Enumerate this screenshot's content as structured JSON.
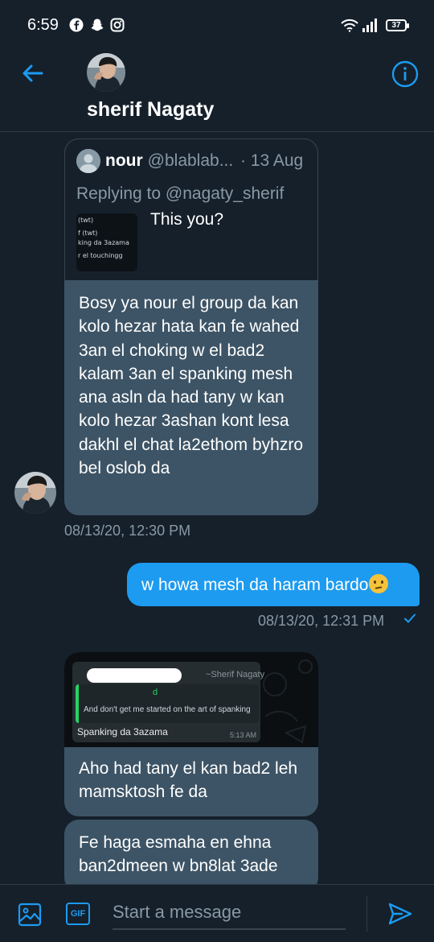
{
  "status_bar": {
    "time": "6:59",
    "icons": [
      "facebook-icon",
      "snapchat-icon",
      "instagram-icon",
      "wifi-icon",
      "signal-icon"
    ],
    "battery": "37"
  },
  "header": {
    "name": "sherif Nagaty",
    "back_icon": "back-arrow-icon",
    "info_icon": "info-icon"
  },
  "quoted_tweet": {
    "author": "nour",
    "handle": "@blablab...",
    "date": "· 13 Aug",
    "replying_prefix": "Replying to ",
    "replying_handle": "@nagaty_sherif",
    "text": "This you?",
    "thumb_lines": [
      "(twt)",
      "f (twt)",
      "king da 3azama",
      "r el touchingg"
    ]
  },
  "messages": [
    {
      "text": "Bosy ya nour el group da kan kolo hezar hata kan fe wahed 3an el choking w el bad2 kalam 3an el spanking mesh ana asln da had tany w kan kolo hezar 3ashan kont lesa dakhl el chat la2ethom byhzro bel oslob da",
      "timestamp": "08/13/20, 12:30 PM"
    },
    {
      "text": "w howa mesh da haram bardo",
      "timestamp": "08/13/20, 12:31 PM"
    },
    {
      "whatsapp_name": "~Sherif Nagaty",
      "whatsapp_quote_mark": "d",
      "whatsapp_quote": "And don't get me started on the art of spanking",
      "whatsapp_message": "Spanking da 3azama",
      "whatsapp_time": "5:13 AM",
      "text": "Aho had tany el kan bad2 leh mamsktosh fe da"
    },
    {
      "text": "Fe haga esmaha en ehna ban2dmeen w bn8lat 3ade"
    }
  ],
  "composer": {
    "placeholder": "Start a message",
    "gif_label": "GIF"
  },
  "colors": {
    "background": "#15202b",
    "received_bubble": "#3d5466",
    "sent_bubble": "#1d9bf0",
    "accent": "#1d9bf0",
    "muted_text": "#8899a6"
  }
}
